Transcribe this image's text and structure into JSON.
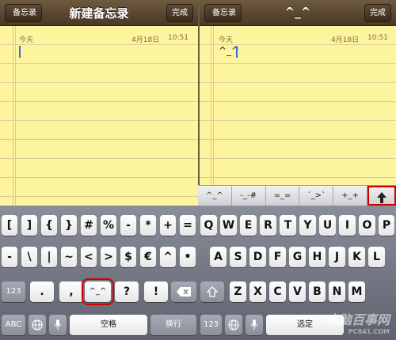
{
  "left_pane": {
    "back_label": "备忘录",
    "title": "新建备忘录",
    "done_label": "完成",
    "date_label": "今天",
    "date_value": "4月18日",
    "time_value": "10:51",
    "note_text": ""
  },
  "right_pane": {
    "back_label": "备忘录",
    "title": "^_^",
    "done_label": "完成",
    "date_label": "今天",
    "date_value": "4月18日",
    "time_value": "10:51",
    "note_text": "^_^"
  },
  "emoticons": [
    "^_^",
    "-_-#",
    "=_=",
    "´_>`",
    "+_+"
  ],
  "keyboard": {
    "row1_left": [
      "[",
      "]",
      "{",
      "}",
      "#",
      "%",
      "-",
      "*",
      "+",
      "="
    ],
    "row1_right": [
      "Q",
      "W",
      "E",
      "R",
      "T",
      "Y",
      "U",
      "I",
      "O",
      "P"
    ],
    "row2_left": [
      "-",
      "\\",
      "|",
      "~",
      "<",
      ">",
      "$",
      "€",
      "^",
      "•"
    ],
    "row2_right": [
      "A",
      "S",
      "D",
      "F",
      "G",
      "H",
      "J",
      "K",
      "L"
    ],
    "row3_left": [
      "123",
      ".",
      ",",
      "^_^",
      "?",
      "!"
    ],
    "row3_right": [
      "Z",
      "X",
      "C",
      "V",
      "B",
      "N",
      "M"
    ],
    "space_label": "空格",
    "return_label": "换行",
    "abc_label": "ABC",
    "num_label": "123",
    "next_label": "选定"
  },
  "watermark": {
    "brand": "电脑百事网",
    "url": "PC841.COM"
  },
  "colors": {
    "highlight": "#d40000",
    "paper": "#fdf59e",
    "navbar": "#5a4630"
  }
}
